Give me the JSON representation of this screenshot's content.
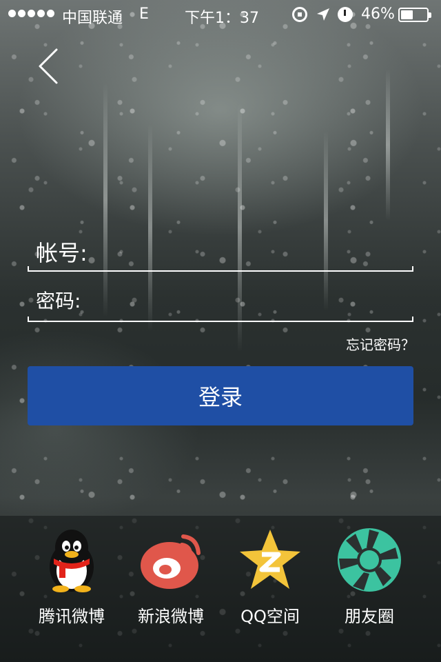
{
  "status_bar": {
    "carrier": "中国联通",
    "network": "E",
    "time": "下午1：37",
    "battery_percent": "46%",
    "battery_level": 0.46,
    "icons": [
      "signal-dots-icon",
      "rotation-lock-icon",
      "location-arrow-icon",
      "alarm-icon",
      "battery-icon"
    ]
  },
  "nav": {
    "back_icon": "chevron-left-icon"
  },
  "form": {
    "account_label": "帐号:",
    "account_value": "",
    "password_label": "密码:",
    "password_value": "",
    "forgot_password": "忘记密码？",
    "login_button": "登录"
  },
  "share": {
    "items": [
      {
        "label": "腾讯微博",
        "icon": "qq-penguin-icon"
      },
      {
        "label": "新浪微博",
        "icon": "sina-weibo-icon"
      },
      {
        "label": "QQ空间",
        "icon": "qzone-star-icon"
      },
      {
        "label": "朋友圈",
        "icon": "wechat-moments-icon"
      }
    ]
  },
  "colors": {
    "login_button": "#1f4fa5",
    "qzone_star": "#f3c43a",
    "weibo_red": "#e0574b",
    "moments_green": "#3cc3a0"
  }
}
